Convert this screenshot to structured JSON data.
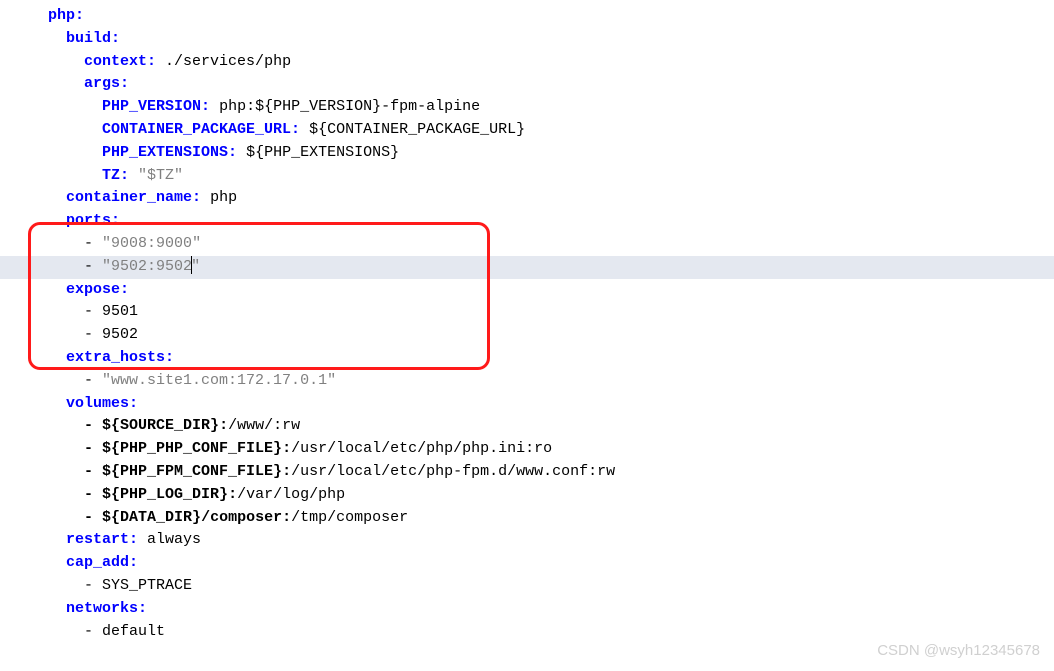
{
  "lines": {
    "l0": {
      "indent": "  ",
      "key": "php",
      "colon": ":"
    },
    "l1": {
      "indent": "    ",
      "key": "build",
      "colon": ":"
    },
    "l2": {
      "indent": "      ",
      "key": "context",
      "colon": ": ",
      "value": "./services/php"
    },
    "l3": {
      "indent": "      ",
      "key": "args",
      "colon": ":"
    },
    "l4": {
      "indent": "        ",
      "key": "PHP_VERSION",
      "colon": ": ",
      "value_pre": "php:",
      "var": "${PHP_VERSION}",
      "value_post": "-fpm-alpine"
    },
    "l5": {
      "indent": "        ",
      "key": "CONTAINER_PACKAGE_URL",
      "colon": ": ",
      "var": "${CONTAINER_PACKAGE_URL}"
    },
    "l6": {
      "indent": "        ",
      "key": "PHP_EXTENSIONS",
      "colon": ": ",
      "var": "${PHP_EXTENSIONS}"
    },
    "l7": {
      "indent": "        ",
      "key": "TZ",
      "colon": ": ",
      "str": "\"$TZ\""
    },
    "l8": {
      "indent": "    ",
      "key": "container_name",
      "colon": ": ",
      "value": "php"
    },
    "l9": {
      "indent": "    ",
      "key": "ports",
      "colon": ":"
    },
    "l10": {
      "indent": "      ",
      "dash": "- ",
      "str_open": "\"",
      "str_body": "9008:9000",
      "str_close": "\""
    },
    "l11": {
      "indent": "      ",
      "dash": "- ",
      "str_open": "\"",
      "str_body": "9502:9502",
      "str_close": "\""
    },
    "l12": {
      "indent": "    ",
      "key": "expose",
      "colon": ":"
    },
    "l13": {
      "indent": "      ",
      "dash": "- ",
      "value": "9501"
    },
    "l14": {
      "indent": "      ",
      "dash": "- ",
      "value": "9502"
    },
    "l15": {
      "indent": "    ",
      "key": "extra_hosts",
      "colon": ":"
    },
    "l16": {
      "indent": "      ",
      "dash": "- ",
      "str": "\"www.site1.com:172.17.0.1\""
    },
    "l17": {
      "indent": "    ",
      "key": "volumes",
      "colon": ":"
    },
    "l18": {
      "indent": "      ",
      "dash_bold": "- ",
      "var_bold": "${SOURCE_DIR}",
      "text_bold": ":",
      "path": "/www/:rw"
    },
    "l19": {
      "indent": "      ",
      "dash_bold": "- ",
      "var_bold": "${PHP_PHP_CONF_FILE}",
      "text_bold": ":",
      "path": "/usr/local/etc/php/php.ini:ro"
    },
    "l20": {
      "indent": "      ",
      "dash_bold": "- ",
      "var_bold": "${PHP_FPM_CONF_FILE}",
      "text_bold": ":",
      "path": "/usr/local/etc/php-fpm.d/www.conf:rw"
    },
    "l21": {
      "indent": "      ",
      "dash_bold": "- ",
      "var_bold": "${PHP_LOG_DIR}",
      "text_bold": ":",
      "path": "/var/log/php"
    },
    "l22": {
      "indent": "      ",
      "dash_bold": "- ",
      "var_bold": "${DATA_DIR}",
      "text_bold2": "/composer:",
      "path": "/tmp/composer"
    },
    "l23": {
      "indent": "    ",
      "key": "restart",
      "colon": ": ",
      "value": "always"
    },
    "l24": {
      "indent": "    ",
      "key": "cap_add",
      "colon": ":"
    },
    "l25": {
      "indent": "      ",
      "dash": "- ",
      "value": "SYS_PTRACE"
    },
    "l26": {
      "indent": "    ",
      "key": "networks",
      "colon": ":"
    },
    "l27": {
      "indent": "      ",
      "dash": "- ",
      "value": "default"
    }
  },
  "watermark": "CSDN @wsyh12345678"
}
